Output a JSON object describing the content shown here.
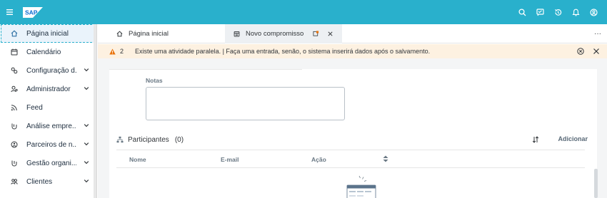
{
  "shell": {
    "logo": "SAP",
    "icons": [
      "search-icon",
      "feedback-icon",
      "history-icon",
      "notifications-icon",
      "user-icon"
    ],
    "color": "#29b0cc"
  },
  "sidebar": {
    "items": [
      {
        "label": "Página inicial",
        "icon": "home-icon",
        "has_chevron": false,
        "active": true
      },
      {
        "label": "Calendário",
        "icon": "calendar-icon",
        "has_chevron": false
      },
      {
        "label": "Configuração d...",
        "icon": "configuration-icon",
        "has_chevron": true
      },
      {
        "label": "Administrador",
        "icon": "admin-icon",
        "has_chevron": true
      },
      {
        "label": "Feed",
        "icon": "feed-icon",
        "has_chevron": false
      },
      {
        "label": "Análise empre...",
        "icon": "analysis-icon",
        "has_chevron": true
      },
      {
        "label": "Parceiros de n...",
        "icon": "partners-icon",
        "has_chevron": true
      },
      {
        "label": "Gestão organi...",
        "icon": "organization-icon",
        "has_chevron": true
      },
      {
        "label": "Clientes",
        "icon": "customers-icon",
        "has_chevron": true
      }
    ]
  },
  "tabs": [
    {
      "label": "Página inicial",
      "icon": "home-icon"
    },
    {
      "label": "Novo compromisso",
      "icon": "appointment-icon",
      "active": true
    }
  ],
  "warning": {
    "count": "2",
    "text": "Existe uma atividade paralela. | Faça uma entrada, senão, o sistema inserirá dados após o salvamento.",
    "color": "#fdf1e1"
  },
  "form": {
    "notes_label": "Notas",
    "notes_value": ""
  },
  "participants": {
    "title": "Participantes",
    "count": "(0)",
    "add_label": "Adicionar",
    "columns": [
      "Nome",
      "E-mail",
      "Ação"
    ]
  }
}
